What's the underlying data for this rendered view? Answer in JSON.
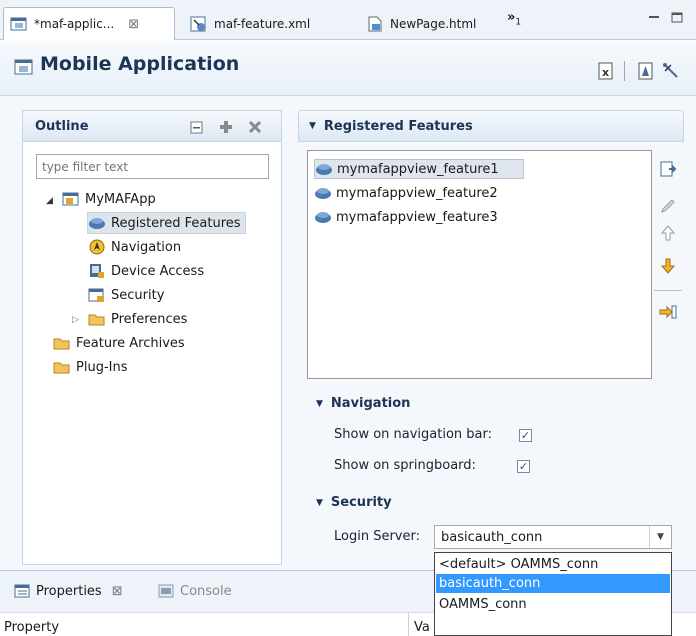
{
  "tabs": [
    {
      "label": "*maf-applic...",
      "close": "⊠"
    },
    {
      "label": "maf-feature.xml"
    },
    {
      "label": "NewPage.html"
    }
  ],
  "overflow": {
    "label": "»",
    "count": "1"
  },
  "header": {
    "title": "Mobile Application"
  },
  "outline": {
    "title": "Outline",
    "filter_placeholder": "type filter text",
    "tree": {
      "root": "MyMAFApp",
      "children": [
        "Registered Features",
        "Navigation",
        "Device Access",
        "Security",
        "Preferences"
      ],
      "others": [
        "Feature Archives",
        "Plug-Ins"
      ]
    }
  },
  "registered": {
    "title": "Registered Features",
    "features": [
      "mymafappview_feature1",
      "mymafappview_feature2",
      "mymafappview_feature3"
    ]
  },
  "navigation": {
    "title": "Navigation",
    "nav_bar_label": "Show on navigation bar:",
    "springboard_label": "Show on springboard:",
    "nav_bar_checked": true,
    "springboard_checked": true
  },
  "security": {
    "title": "Security",
    "login_label": "Login Server:",
    "login_value": "basicauth_conn",
    "options": [
      "<default> OAMMS_conn",
      "basicauth_conn",
      "OAMMS_conn"
    ]
  },
  "bottom": {
    "properties_tab": "Properties",
    "properties_close": "⊠",
    "console_tab": "Console",
    "col_property": "Property",
    "col_value": "Va"
  },
  "colors": {
    "accent": "#1c3557",
    "selection": "#3399ff",
    "border": "#c6d6e7"
  }
}
